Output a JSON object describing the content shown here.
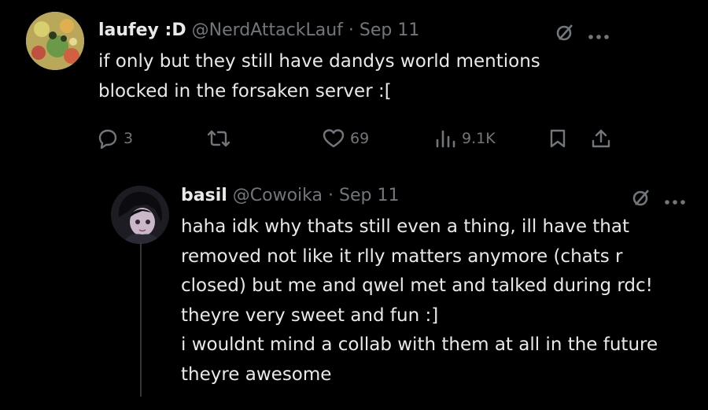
{
  "tweet1": {
    "display_name": "laufey :D",
    "handle": "@NerdAttackLauf",
    "date": "Sep 11",
    "text_lines": [
      "if only but they still have dandys world mentions",
      "blocked in the forsaken server :["
    ],
    "replies": "3",
    "likes": "69",
    "views": "9.1K"
  },
  "tweet2": {
    "display_name": "basil",
    "handle": "@Cowoika",
    "date": "Sep 11",
    "text_lines": [
      "haha idk why thats still even a thing, ill have that",
      "removed not like it rlly matters anymore (chats r",
      "closed) but me and qwel met and talked during rdc!",
      "theyre very sweet and fun :]",
      "i wouldnt mind a collab with them at all in the future",
      "theyre awesome"
    ]
  },
  "separator": "·",
  "colors": {
    "background": "#000000",
    "text": "#e7e9ea",
    "secondary": "#71767b"
  },
  "icons": [
    "grok-icon",
    "more-icon",
    "reply-icon",
    "retweet-icon",
    "like-icon",
    "views-icon",
    "bookmark-icon",
    "share-icon"
  ]
}
